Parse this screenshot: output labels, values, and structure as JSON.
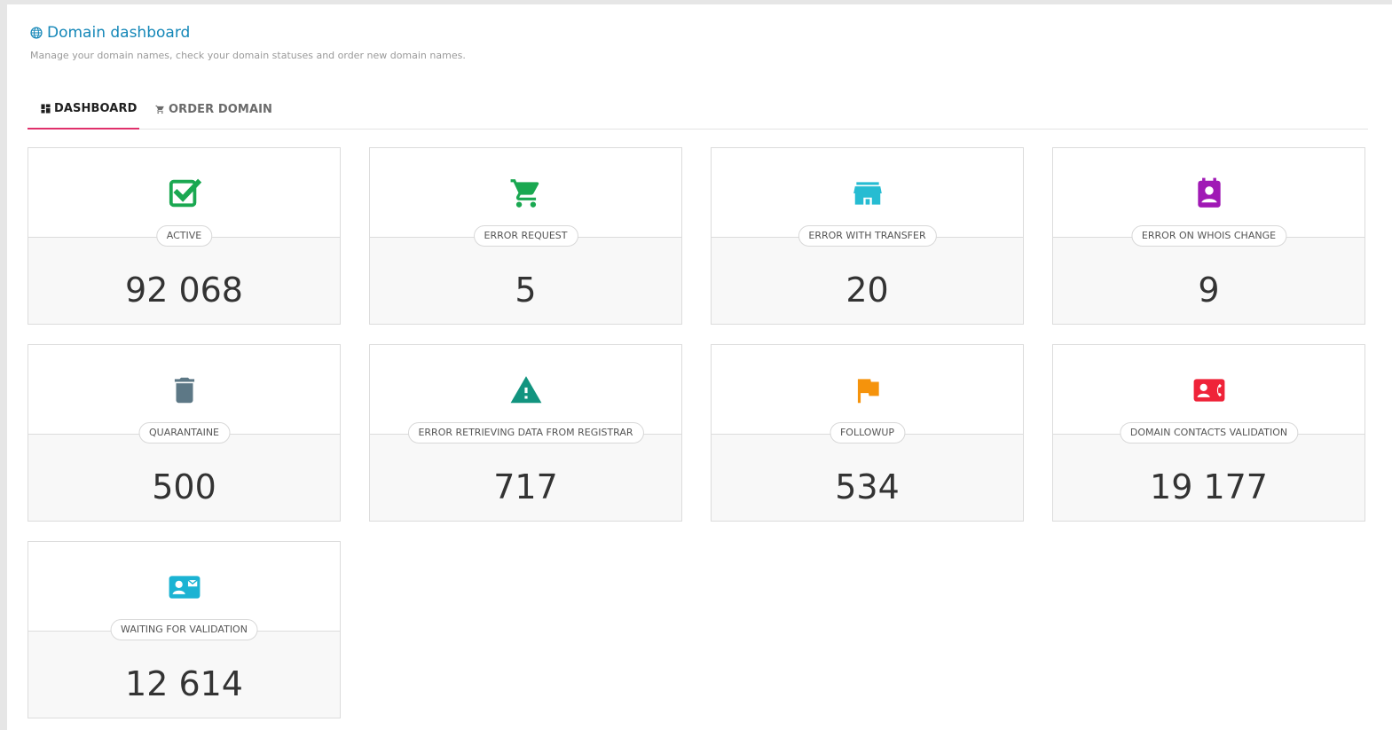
{
  "header": {
    "title": "Domain dashboard",
    "subtitle": "Manage your domain names, check your domain statuses and order new domain names."
  },
  "tabs": [
    {
      "label": "DASHBOARD",
      "active": true,
      "icon": "dashboard-icon"
    },
    {
      "label": "ORDER DOMAIN",
      "active": false,
      "icon": "cart-icon"
    }
  ],
  "cards": [
    {
      "label": "ACTIVE",
      "value": "92 068",
      "icon": "checkbox-icon",
      "color": "#1aa851"
    },
    {
      "label": "ERROR REQUEST",
      "value": "5",
      "icon": "cart-icon",
      "color": "#1aa851"
    },
    {
      "label": "ERROR WITH TRANSFER",
      "value": "20",
      "icon": "store-icon",
      "color": "#26bcd2"
    },
    {
      "label": "ERROR ON WHOIS CHANGE",
      "value": "9",
      "icon": "account-box-icon",
      "color": "#a019b5"
    },
    {
      "label": "QUARANTAINE",
      "value": "500",
      "icon": "trash-icon",
      "color": "#5d7886"
    },
    {
      "label": "ERROR RETRIEVING DATA FROM REGISTRAR",
      "value": "717",
      "icon": "warning-icon",
      "color": "#12947f"
    },
    {
      "label": "FOLLOWUP",
      "value": "534",
      "icon": "flag-icon",
      "color": "#f5930c"
    },
    {
      "label": "DOMAIN CONTACTS VALIDATION",
      "value": "19 177",
      "icon": "contact-phone-icon",
      "color": "#ef2339"
    },
    {
      "label": "WAITING FOR VALIDATION",
      "value": "12 614",
      "icon": "contact-mail-icon",
      "color": "#1bb3d3"
    }
  ],
  "colors": {
    "accent": "#e0306b",
    "title": "#1487b8"
  }
}
